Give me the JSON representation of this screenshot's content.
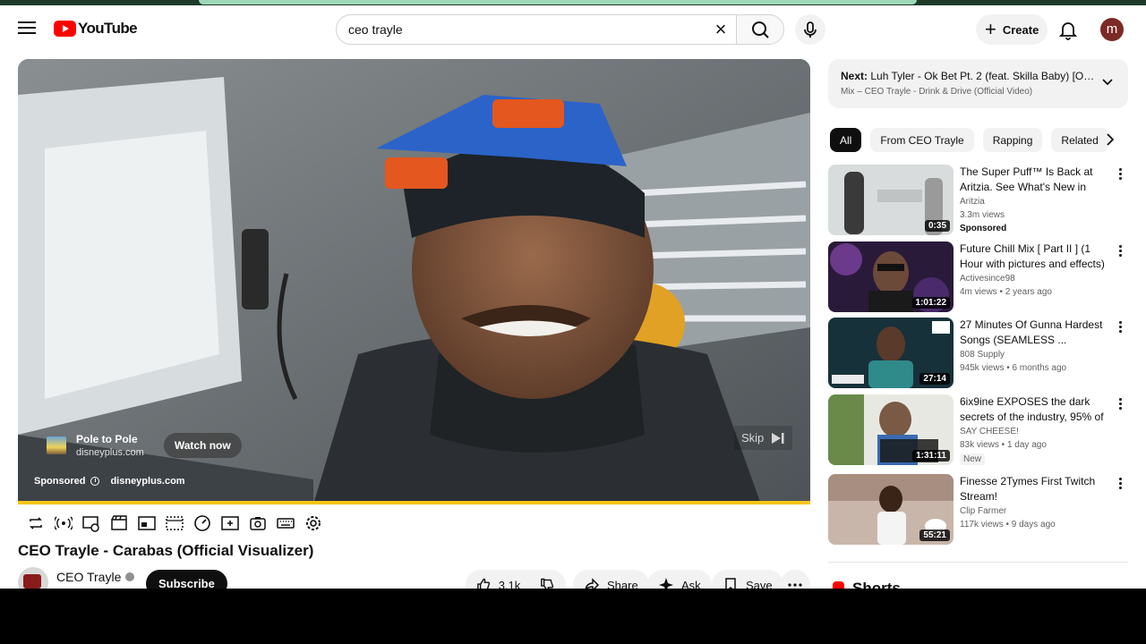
{
  "topbar": {
    "logo_text": "YouTube",
    "search_value": "ceo trayle",
    "create_label": "Create",
    "avatar_letter": "m"
  },
  "player": {
    "ad_title": "Pole to Pole",
    "ad_domain": "disneyplus.com",
    "watch_now_label": "Watch now",
    "sponsored_label": "Sponsored",
    "sponsored_domain": "disneyplus.com",
    "skip_label": "Skip"
  },
  "video": {
    "title": "CEO Trayle - Carabas (Official Visualizer)",
    "channel": "CEO Trayle",
    "subscribe_label": "Subscribe",
    "likes": "3.1k",
    "share_label": "Share",
    "ask_label": "Ask",
    "save_label": "Save"
  },
  "upnext": {
    "prefix": "Next:",
    "title": "Luh Tyler - Ok Bet Pt. 2 (feat. Skilla Baby) [Offi...",
    "mix": "Mix – CEO Trayle - Drink & Drive (Official Video)"
  },
  "chips": [
    "All",
    "From CEO Trayle",
    "Rapping",
    "Related"
  ],
  "recommendations": [
    {
      "title": "The Super Puff™ Is Back at Aritzia. See What's New in the...",
      "channel": "Aritzia",
      "meta": "3.3m views",
      "duration": "0:35",
      "badge": "Sponsored"
    },
    {
      "title": "Future Chill Mix [ Part II ] (1 Hour with pictures and effects)",
      "channel": "Activesince98",
      "meta": "4m views • 2 years ago",
      "duration": "1:01:22",
      "badge": ""
    },
    {
      "title": "27 Minutes Of Gunna Hardest Songs (SEAMLESS ...",
      "channel": "808 Supply",
      "meta": "945k views • 6 months ago",
      "duration": "27:14",
      "badge": ""
    },
    {
      "title": "6ix9ine EXPOSES the dark secrets of the industry, 95% of ...",
      "channel": "SAY CHEESE!",
      "meta": "83k views • 1 day ago",
      "duration": "1:31:11",
      "badge": "New"
    },
    {
      "title": "Finesse 2Tymes First Twitch Stream!",
      "channel": "Clip Farmer",
      "meta": "117k views • 9 days ago",
      "duration": "55:21",
      "badge": ""
    }
  ],
  "shorts_label": "Shorts"
}
